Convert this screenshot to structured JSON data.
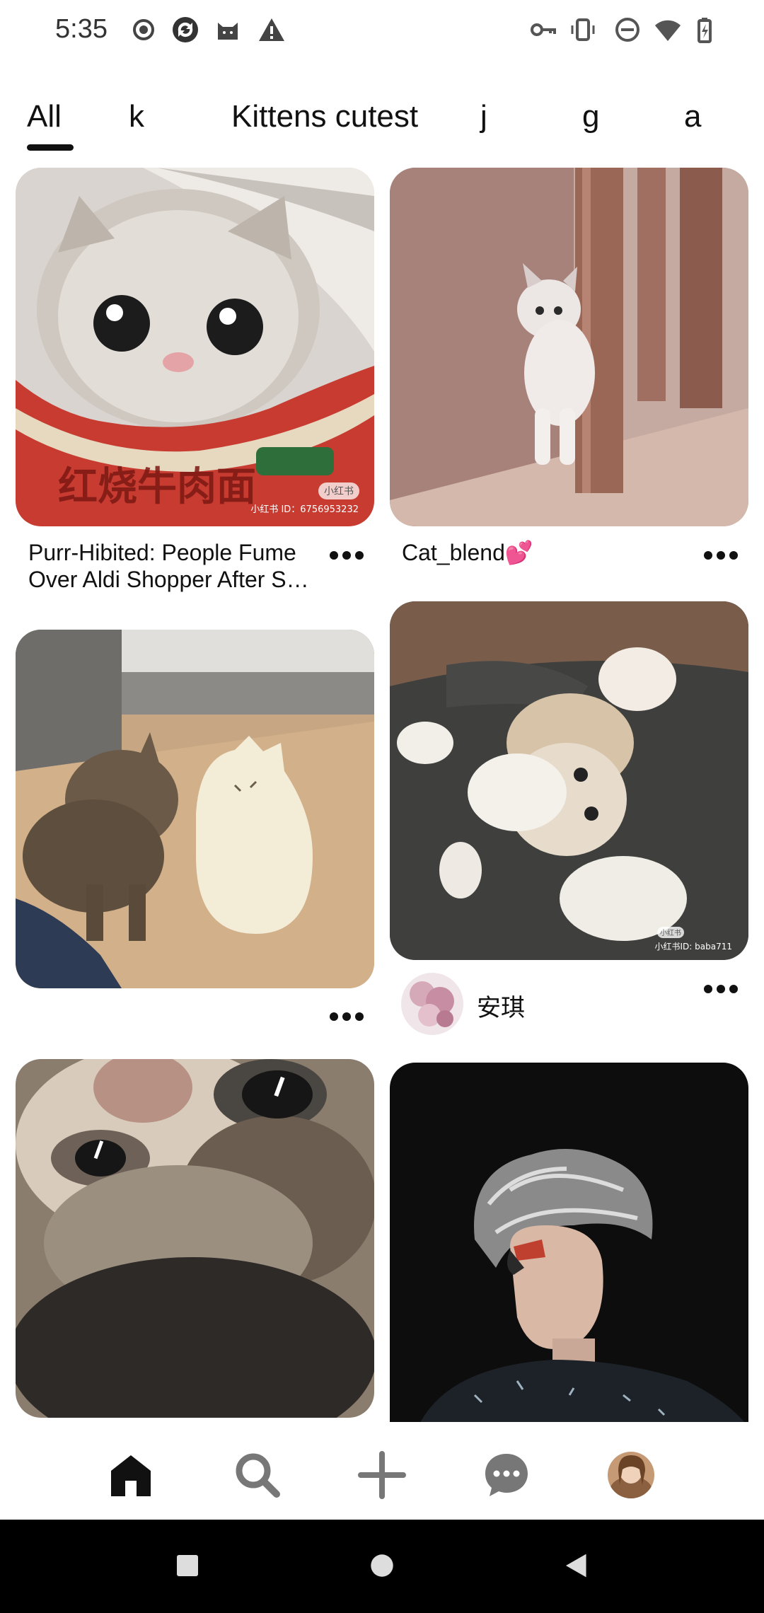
{
  "status_bar": {
    "time": "5:35",
    "left_icons": [
      "record-icon",
      "sync-icon",
      "cat-icon",
      "warning-icon"
    ],
    "right_icons": [
      "key-icon",
      "vibrate-icon",
      "dnd-icon",
      "wifi-icon",
      "battery-icon"
    ]
  },
  "tabs": [
    {
      "label": "All",
      "selected": true
    },
    {
      "label": "k",
      "selected": false
    },
    {
      "label": "Kittens cutest",
      "selected": false
    },
    {
      "label": "j",
      "selected": false
    },
    {
      "label": "g",
      "selected": false
    },
    {
      "label": "a",
      "selected": false
    }
  ],
  "feed": {
    "pin1": {
      "title": "Purr-Hibited: People Fume Over Aldi Shopper After S…",
      "image": "kitten-in-noodle-cup",
      "watermark_badge": "小红书",
      "watermark_id": "小红书 ID：6756953232"
    },
    "pin2": {
      "title": "Cat_blend💕",
      "image": "kitten-hugging-table-leg"
    },
    "pin3": {
      "title": "",
      "image": "kitten-with-cat-lamp"
    },
    "pin4": {
      "user": "安琪",
      "image": "kitten-lying-on-blanket",
      "watermark_badge": "小红书",
      "watermark_id": "小红书ID: baba711"
    },
    "pin5": {
      "image": "blurry-kitten-closeup"
    },
    "pin6": {
      "image": "man-with-silver-hair"
    }
  },
  "bottom_nav": {
    "items": [
      "home-icon",
      "search-icon",
      "create-icon",
      "messages-icon",
      "profile-avatar"
    ],
    "active": "home-icon"
  },
  "system_nav": [
    "recents-button",
    "home-button",
    "back-button"
  ]
}
